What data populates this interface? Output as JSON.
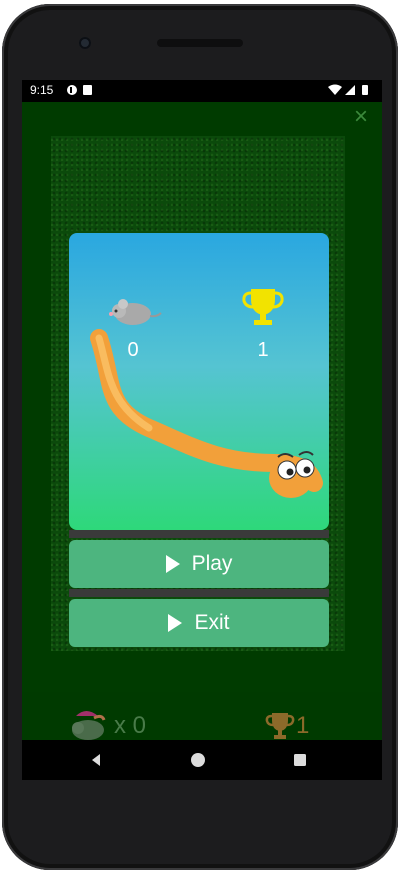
{
  "status": {
    "time": "9:15",
    "left_icons": [
      "app-notification-icon",
      "sd-card-icon"
    ],
    "right_icons": [
      "wifi-icon",
      "signal-icon",
      "battery-icon"
    ]
  },
  "game": {
    "close_label": "×",
    "dialog": {
      "mouse_score": "0",
      "best_score": "1",
      "play_label": "Play",
      "exit_label": "Exit"
    },
    "hud": {
      "mice_count": "x 0",
      "best": "1"
    }
  },
  "colors": {
    "accent_button": "#4db57f",
    "trophy_gold": "#f2e300",
    "snake_orange": "#f7a93c"
  }
}
